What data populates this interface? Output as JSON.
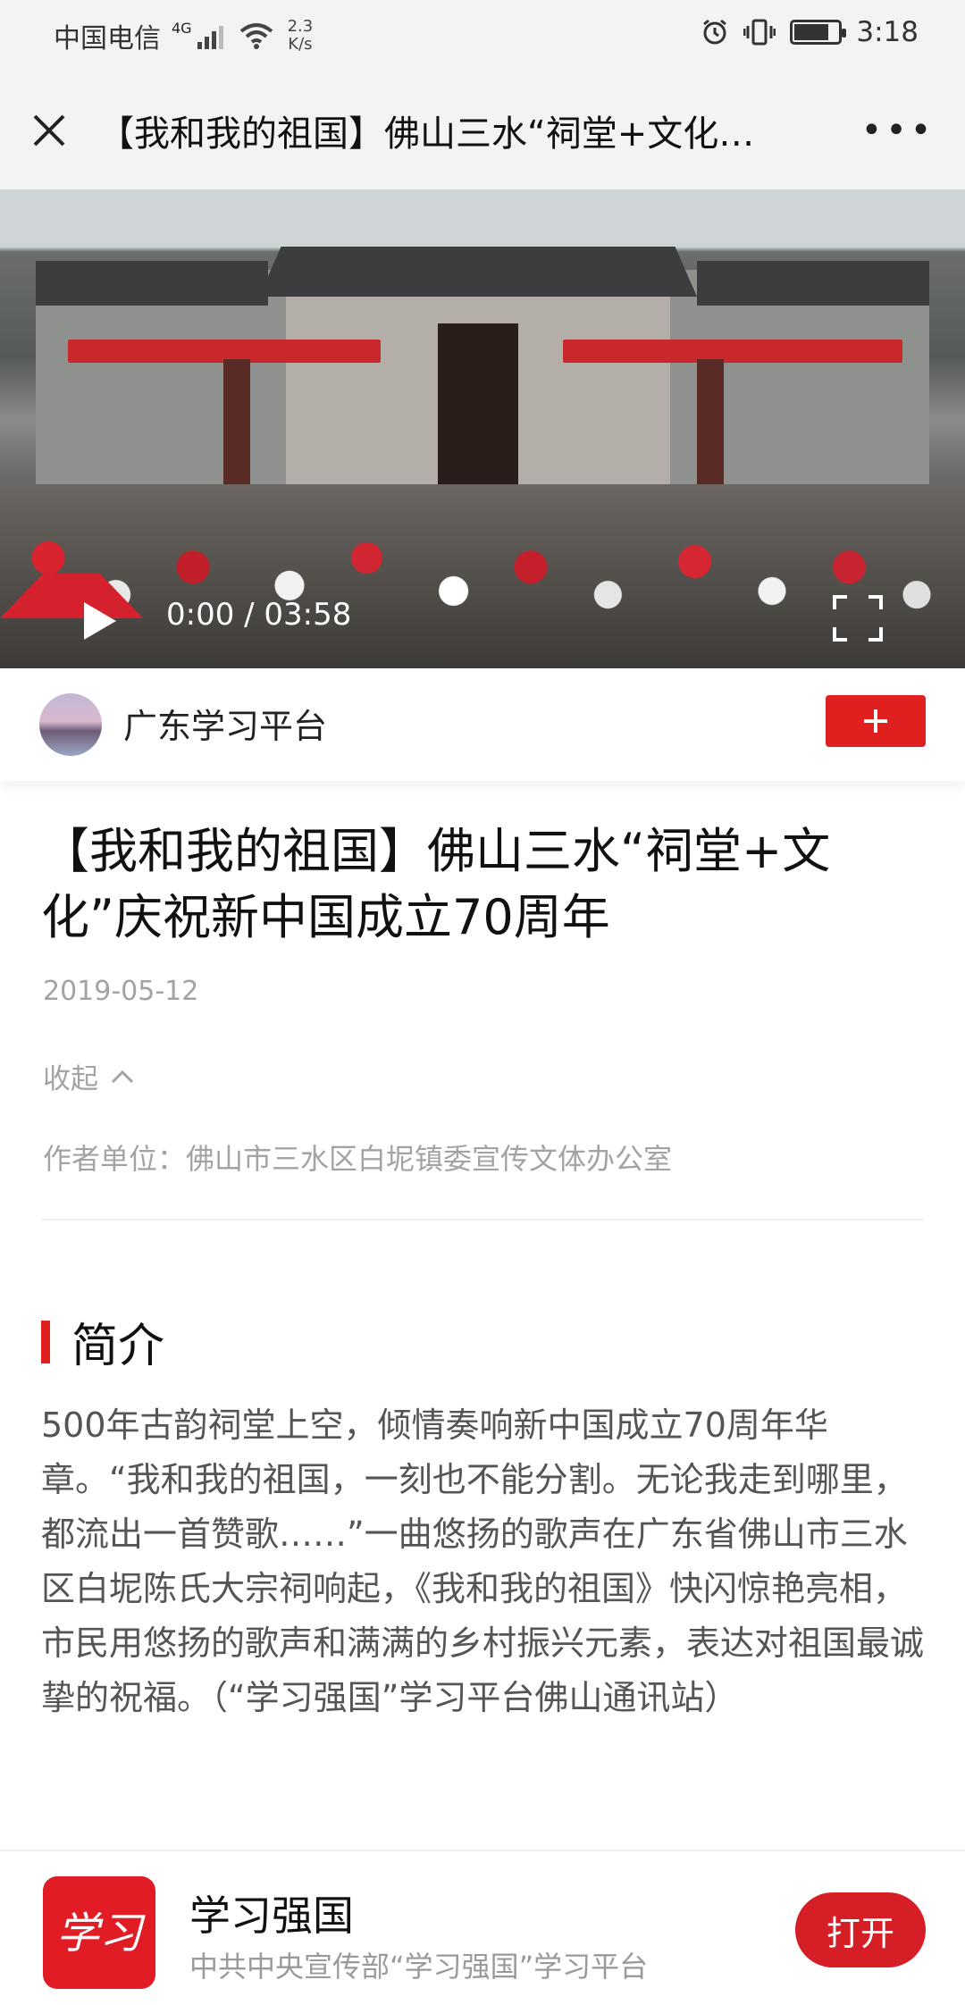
{
  "status_bar": {
    "carrier": "中国电信",
    "network": "4G",
    "speed": "2.3",
    "speed_unit": "K/s",
    "time": "3:18"
  },
  "header": {
    "title": "【我和我的祖国】佛山三水“祠堂+文化…",
    "more_label": "•••"
  },
  "video": {
    "time_display": "0:00 / 03:58"
  },
  "channel": {
    "name": "广东学习平台",
    "follow_label": "+"
  },
  "article": {
    "title": "【我和我的祖国】佛山三水“祠堂+文化”庆祝新中国成立70周年",
    "date": "2019-05-12",
    "collapse_label": "收起",
    "author": "作者单位：佛山市三水区白坭镇委宣传文体办公室",
    "section_title": "简介",
    "summary": "500年古韵祠堂上空，倾情奏响新中国成立70周年华章。“我和我的祖国，一刻也不能分割。无论我走到哪里，都流出一首赞歌……”一曲悠扬的歌声在广东省佛山市三水区白坭陈氏大宗祠响起，《我和我的祖国》快闪惊艳亮相，市民用悠扬的歌声和满满的乡村振兴元素，表达对祖国最诚挚的祝福。（“学习强国”学习平台佛山通讯站）"
  },
  "app_banner": {
    "logo_text": "学习",
    "app_name": "学习强国",
    "subtitle": "中共中央宣传部“学习强国”学习平台",
    "open_label": "打开"
  },
  "colors": {
    "accent_red": "#e01f1f",
    "text_gray": "#a3a3a3"
  }
}
